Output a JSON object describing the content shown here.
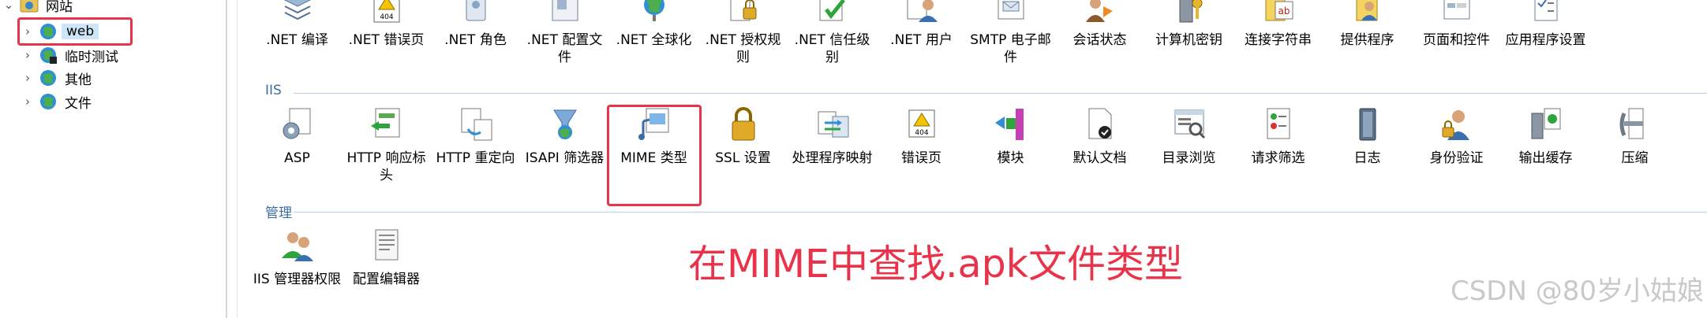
{
  "tree": {
    "root": {
      "label": "网站"
    },
    "nodes": [
      {
        "label": "web"
      },
      {
        "label": "临时测试"
      },
      {
        "label": "其他"
      },
      {
        "label": "文件"
      }
    ]
  },
  "top_row": [
    {
      "label": ".NET 编译",
      "icon": "net-compile-icon"
    },
    {
      "label": ".NET 错误页",
      "icon": "net-error-page-icon"
    },
    {
      "label": ".NET 角色",
      "icon": "net-roles-icon"
    },
    {
      "label": ".NET 配置文件",
      "icon": "net-profile-icon"
    },
    {
      "label": ".NET 全球化",
      "icon": "net-globalization-icon"
    },
    {
      "label": ".NET 授权规则",
      "icon": "net-authorization-icon"
    },
    {
      "label": ".NET 信任级别",
      "icon": "net-trust-level-icon"
    },
    {
      "label": ".NET 用户",
      "icon": "net-users-icon"
    },
    {
      "label": "SMTP 电子邮件",
      "icon": "smtp-email-icon"
    },
    {
      "label": "会话状态",
      "icon": "session-state-icon"
    },
    {
      "label": "计算机密钥",
      "icon": "machine-key-icon"
    },
    {
      "label": "连接字符串",
      "icon": "connection-strings-icon"
    },
    {
      "label": "提供程序",
      "icon": "providers-icon"
    },
    {
      "label": "页面和控件",
      "icon": "pages-controls-icon"
    },
    {
      "label": "应用程序设置",
      "icon": "app-settings-icon"
    }
  ],
  "groups": {
    "iis": {
      "label": "IIS",
      "items": [
        {
          "label": "ASP",
          "icon": "asp-icon"
        },
        {
          "label": "HTTP 响应标头",
          "icon": "http-response-headers-icon"
        },
        {
          "label": "HTTP 重定向",
          "icon": "http-redirect-icon"
        },
        {
          "label": "ISAPI 筛选器",
          "icon": "isapi-filters-icon"
        },
        {
          "label": "MIME 类型",
          "icon": "mime-types-icon"
        },
        {
          "label": "SSL 设置",
          "icon": "ssl-settings-icon"
        },
        {
          "label": "处理程序映射",
          "icon": "handler-mappings-icon"
        },
        {
          "label": "错误页",
          "icon": "error-pages-icon"
        },
        {
          "label": "模块",
          "icon": "modules-icon"
        },
        {
          "label": "默认文档",
          "icon": "default-document-icon"
        },
        {
          "label": "目录浏览",
          "icon": "directory-browsing-icon"
        },
        {
          "label": "请求筛选",
          "icon": "request-filtering-icon"
        },
        {
          "label": "日志",
          "icon": "logging-icon"
        },
        {
          "label": "身份验证",
          "icon": "authentication-icon"
        },
        {
          "label": "输出缓存",
          "icon": "output-caching-icon"
        },
        {
          "label": "压缩",
          "icon": "compression-icon"
        }
      ]
    },
    "management": {
      "label": "管理",
      "items": [
        {
          "label": "IIS 管理器权限",
          "icon": "iis-manager-permissions-icon"
        },
        {
          "label": "配置编辑器",
          "icon": "configuration-editor-icon"
        }
      ]
    }
  },
  "annotation": {
    "text": "在MIME中查找.apk文件类型",
    "color": "#e8334a"
  },
  "watermark": {
    "text": "CSDN @80岁小姑娘"
  },
  "colors": {
    "highlight": "#e8334a",
    "group_label": "#3b6ea5",
    "selection": "#cde6f7"
  }
}
